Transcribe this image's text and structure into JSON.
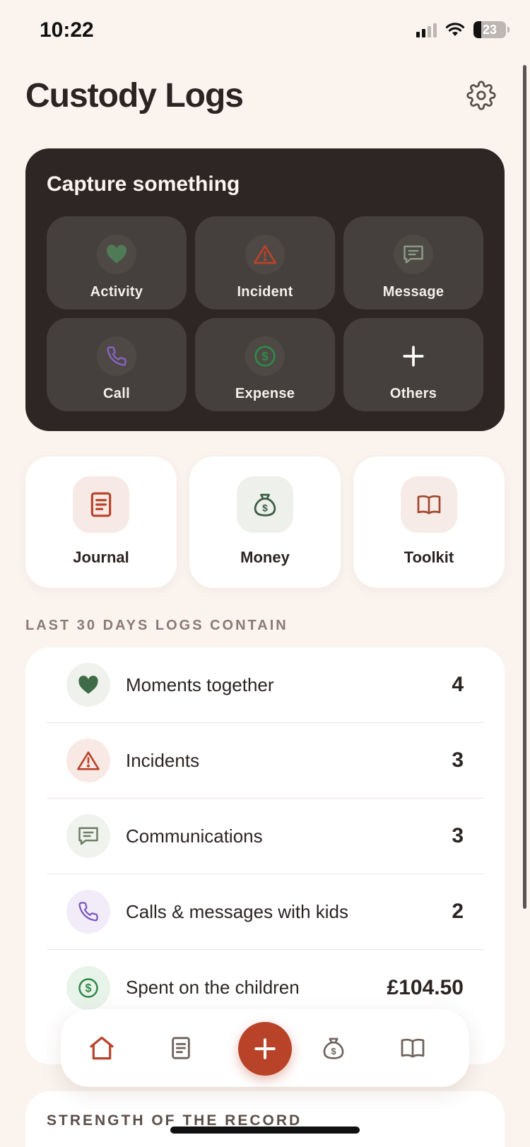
{
  "status_bar": {
    "time": "10:22",
    "battery": "23"
  },
  "header": {
    "title": "Custody Logs",
    "settings_icon": "gear-icon"
  },
  "capture": {
    "title": "Capture something",
    "items": [
      {
        "label": "Activity",
        "icon": "heart-icon",
        "color": "#4f7a56"
      },
      {
        "label": "Incident",
        "icon": "warning-icon",
        "color": "#b94328"
      },
      {
        "label": "Message",
        "icon": "message-icon",
        "color": "#8a9a84"
      },
      {
        "label": "Call",
        "icon": "phone-icon",
        "color": "#8a66c9"
      },
      {
        "label": "Expense",
        "icon": "dollar-circle-icon",
        "color": "#2e8a48"
      },
      {
        "label": "Others",
        "icon": "plus-icon",
        "color": "#ffffff"
      }
    ]
  },
  "quick_nav": [
    {
      "label": "Journal",
      "icon": "document-icon",
      "color": "#b94328",
      "bg": "#f7e9e5"
    },
    {
      "label": "Money",
      "icon": "money-bag-icon",
      "color": "#3d5e44",
      "bg": "#eef0ec"
    },
    {
      "label": "Toolkit",
      "icon": "book-icon",
      "color": "#a0492f",
      "bg": "#f7ebe7"
    }
  ],
  "summary": {
    "section_label": "LAST 30 DAYS LOGS CONTAIN",
    "rows": [
      {
        "label": "Moments together",
        "value": "4",
        "icon": "heart-icon",
        "color": "#3f6b47",
        "bg": "#eef1ec"
      },
      {
        "label": "Incidents",
        "value": "3",
        "icon": "warning-icon",
        "color": "#b94328",
        "bg": "#f8e9e5"
      },
      {
        "label": "Communications",
        "value": "3",
        "icon": "message-icon",
        "color": "#6e7d66",
        "bg": "#f0f2ee"
      },
      {
        "label": "Calls & messages with kids",
        "value": "2",
        "icon": "phone-icon",
        "color": "#7a55c0",
        "bg": "#f1ecf8"
      },
      {
        "label": "Spent on the children",
        "value": "£104.50",
        "icon": "dollar-circle-icon",
        "color": "#2e8a48",
        "bg": "#e8f3ea"
      }
    ]
  },
  "bottom_nav": [
    {
      "name": "home",
      "icon": "home-icon"
    },
    {
      "name": "journal",
      "icon": "document-icon"
    },
    {
      "name": "add",
      "icon": "plus-icon"
    },
    {
      "name": "money",
      "icon": "money-bag-icon"
    },
    {
      "name": "toolkit",
      "icon": "book-icon"
    }
  ],
  "strength": {
    "section_label": "STRENGTH OF THE RECORD"
  }
}
